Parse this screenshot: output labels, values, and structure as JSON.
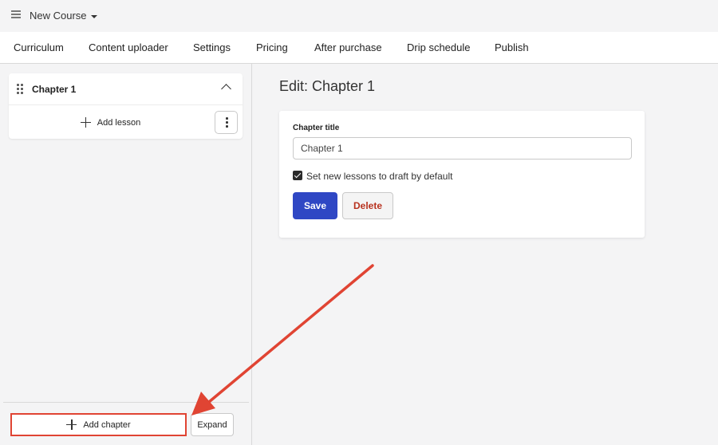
{
  "header": {
    "course_title": "New Course"
  },
  "tabs": [
    {
      "label": "Curriculum"
    },
    {
      "label": "Content uploader"
    },
    {
      "label": "Settings"
    },
    {
      "label": "Pricing"
    },
    {
      "label": "After purchase"
    },
    {
      "label": "Drip schedule"
    },
    {
      "label": "Publish"
    }
  ],
  "sidebar": {
    "chapter_name": "Chapter 1",
    "add_lesson_label": "Add lesson",
    "add_chapter_label": "Add chapter",
    "expand_label": "Expand"
  },
  "editor": {
    "heading": "Edit: Chapter 1",
    "field_label": "Chapter title",
    "title_value": "Chapter 1",
    "draft_checkbox_label": "Set new lessons to draft by default",
    "draft_checked": true,
    "save_label": "Save",
    "delete_label": "Delete"
  },
  "colors": {
    "primary": "#2f47c4",
    "danger_text": "#b8321f",
    "annotation": "#e04433"
  }
}
